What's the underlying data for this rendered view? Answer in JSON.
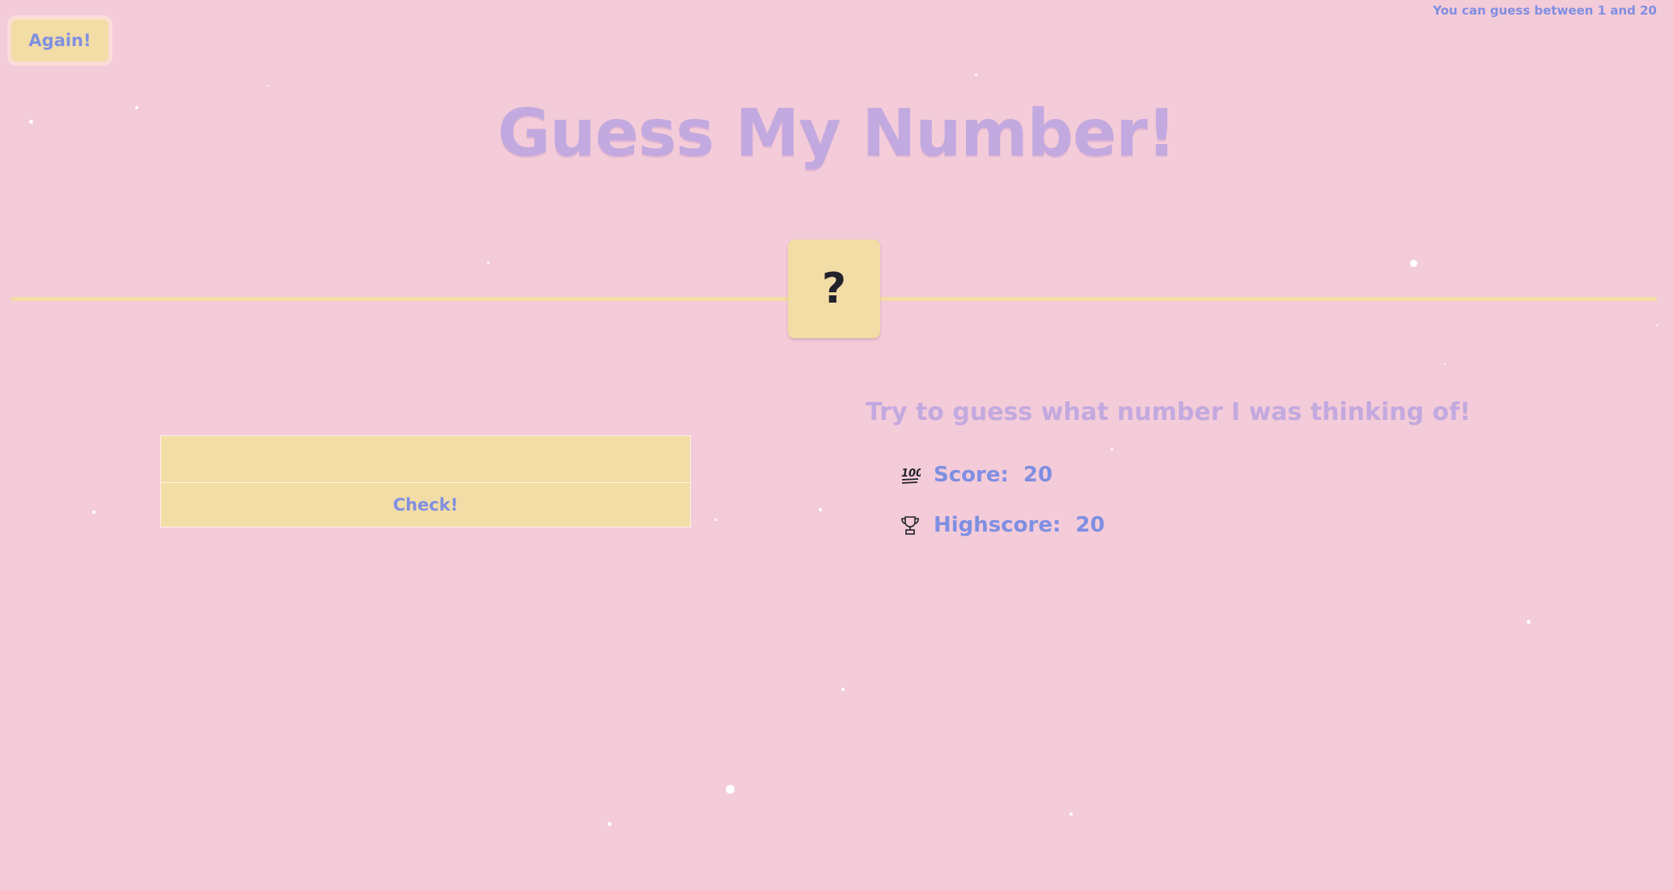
{
  "header": {
    "again_label": "Again!",
    "range_hint": "You can guess between 1 and 20"
  },
  "title": "Guess My Number!",
  "secret": {
    "display": "?"
  },
  "guess": {
    "input_value": "",
    "check_label": "Check!"
  },
  "message": "Try to guess what number I was thinking of!",
  "stats": {
    "score_icon": "hundred-points-icon",
    "score_label": "Score:",
    "score_value": "20",
    "highscore_icon": "trophy-icon",
    "highscore_label": "Highscore:",
    "highscore_value": "20"
  },
  "colors": {
    "background": "#f4cbd8",
    "accent_yellow": "#f3dda6",
    "text_blue": "#7f8fe2",
    "title_lilac": "#c2a9df"
  }
}
